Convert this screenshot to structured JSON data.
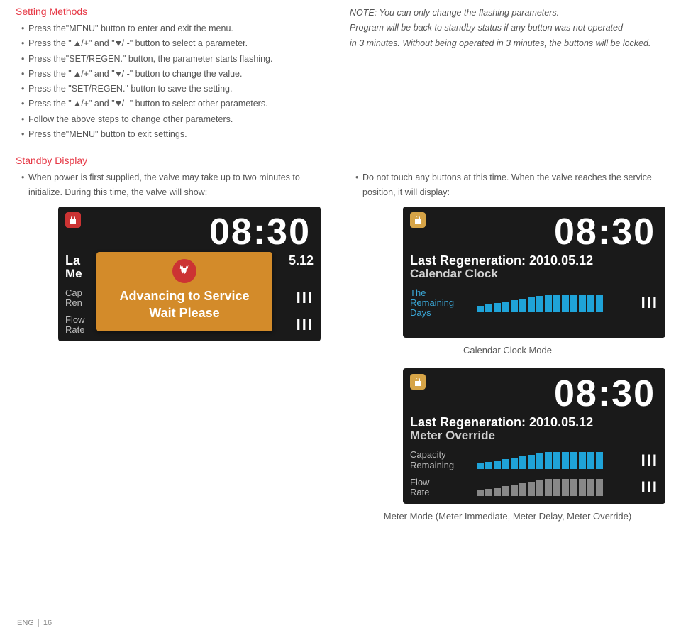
{
  "settingMethods": {
    "title": "Setting Methods",
    "items": [
      "Press the\"MENU\" button to enter and exit the menu.",
      "Press the \" ▲/+\" and \"▼/ -\" button to select a parameter.",
      "Press the\"SET/REGEN.\" button, the parameter starts flashing.",
      "Press the \" ▲/+\" and \"▼/ -\" button to change the value.",
      "Press the \"SET/REGEN.\" button to save the setting.",
      "Press the \" ▲/+\" and \"▼/ -\" button to select other parameters.",
      "Follow the above steps to change other parameters.",
      "Press the\"MENU\" button to exit settings."
    ]
  },
  "noteBlock": {
    "line1": "NOTE: You can only change the flashing parameters.",
    "line2": "Program will be back to standby status if any button was not operated",
    "line3": "in 3 minutes. Without being operated in 3 minutes, the buttons will be locked."
  },
  "standby": {
    "title": "Standby Display",
    "leftItem": "When power is first supplied, the valve may take up to two minutes to initialize. During this time, the valve will show:",
    "rightItem": "Do not touch any buttons at this time. When the valve reaches the service position, it will display:"
  },
  "panel1": {
    "time": "08:30",
    "l1a": "La",
    "l1b": "5.12",
    "l2": "Me",
    "cap": "Cap",
    "ren": "Ren",
    "flow1": "Flow",
    "flow2": "Rate",
    "modal1": "Advancing to Service",
    "modal2": "Wait Please"
  },
  "panel2": {
    "time": "08:30",
    "l1": "Last Regeneration: 2010.05.12",
    "l2": "Calendar Clock",
    "r1": "The",
    "r2": "Remaining",
    "r3": "Days",
    "caption": "Calendar Clock Mode"
  },
  "panel3": {
    "time": "08:30",
    "l1": "Last Regeneration: 2010.05.12",
    "l2": "Meter Override",
    "c1": "Capacity",
    "c2": "Remaining",
    "f1": "Flow",
    "f2": "Rate",
    "caption": "Meter Mode (Meter Immediate, Meter Delay, Meter Override)"
  },
  "footer": {
    "lang": "ENG",
    "page": "16"
  }
}
